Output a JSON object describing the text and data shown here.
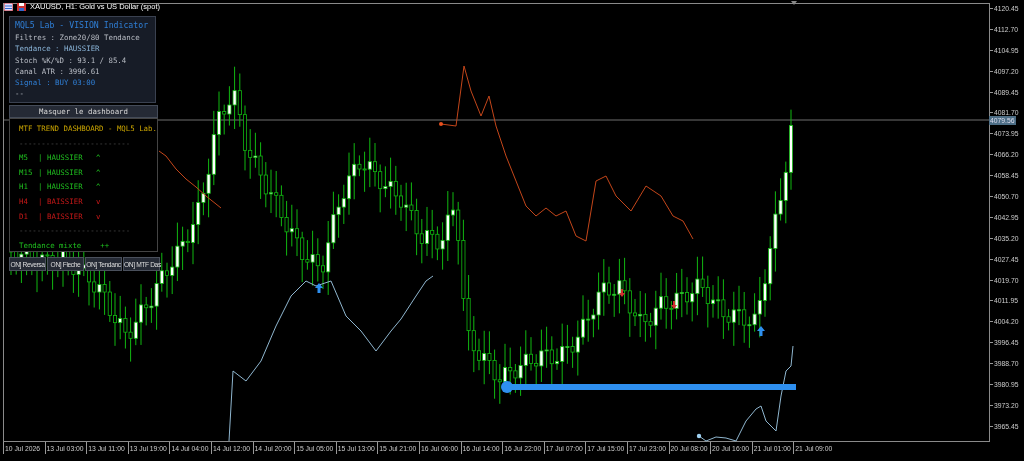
{
  "window": {
    "symbol_title": "XAUUSD, H1:  Gold vs US Dollar (spot)"
  },
  "vision_panel": {
    "title": "MQL5 Lab - VISION Indicator",
    "lines": [
      {
        "text": "Filtres : Zone20/80 Tendance",
        "kind": "normal"
      },
      {
        "text": "Tendance : HAUSSIER",
        "kind": "trend"
      },
      {
        "text": "Stoch %K/%D : 93.1 / 85.4",
        "kind": "normal"
      },
      {
        "text": "Canal ATR : 3996.61",
        "kind": "normal"
      },
      {
        "text": "Signal : BUY 03:00",
        "kind": "signal"
      },
      {
        "text": "--",
        "kind": "normal"
      }
    ]
  },
  "hide_button": "Masquer le dashboard",
  "mtf_dashboard": {
    "title": "MTF TREND DASHBOARD - MQL5 Lab.",
    "separator_top": "-------------------------",
    "rows": [
      {
        "kind": "bullish",
        "timeframe": "M5",
        "divider": "|",
        "trend": "HAUSSIER",
        "arrow": "^"
      },
      {
        "kind": "bullish",
        "timeframe": "M15",
        "divider": "|",
        "trend": "HAUSSIER",
        "arrow": "^"
      },
      {
        "kind": "bullish",
        "timeframe": "H1",
        "divider": "|",
        "trend": "HAUSSIER",
        "arrow": "^"
      },
      {
        "kind": "bearish",
        "timeframe": "H4",
        "divider": "|",
        "trend": "BAISSIER",
        "arrow": "v"
      },
      {
        "kind": "bearish",
        "timeframe": "D1",
        "divider": "|",
        "trend": "BAISSIER",
        "arrow": "v"
      }
    ],
    "separator_bottom": "-------------------------",
    "summary": "Tendance mixte",
    "summary_mark": "++"
  },
  "toggle_buttons": [
    "ON] Reversa",
    "ON] Fleche",
    "ON] Tendanc",
    "ON] MTF Das"
  ],
  "price_axis": {
    "labels": [
      "4120.45",
      "4112.70",
      "4104.95",
      "4097.20",
      "4089.45",
      "4081.70",
      "4073.95",
      "4066.20",
      "4058.45",
      "4050.70",
      "4042.95",
      "4035.20",
      "4027.45",
      "4019.70",
      "4011.95",
      "4004.20",
      "3996.45",
      "3988.70",
      "3980.95",
      "3973.20",
      "3965.45"
    ],
    "current_price": "4079.56"
  },
  "time_axis": {
    "labels": [
      "10 Jul 2026",
      "13 Jul 03:00",
      "13 Jul 11:00",
      "13 Jul 19:00",
      "14 Jul 04:00",
      "14 Jul 12:00",
      "14 Jul 20:00",
      "15 Jul 05:00",
      "15 Jul 13:00",
      "15 Jul 21:00",
      "16 Jul 06:00",
      "16 Jul 14:00",
      "16 Jul 22:00",
      "17 Jul 07:00",
      "17 Jul 15:00",
      "17 Jul 23:00",
      "20 Jul 08:00",
      "20 Jul 16:00",
      "21 Jul 01:00",
      "21 Jul 09:00"
    ]
  }
}
